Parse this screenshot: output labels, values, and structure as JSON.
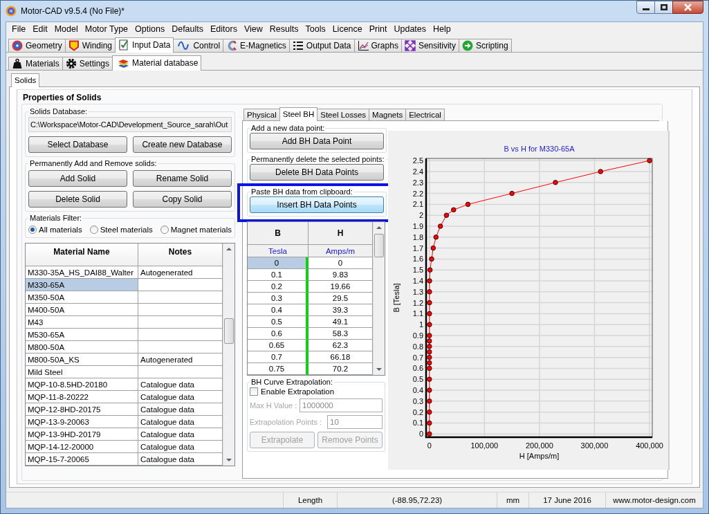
{
  "window": {
    "title": "Motor-CAD v9.5.4 (No File)*"
  },
  "menu": [
    "File",
    "Edit",
    "Model",
    "Motor Type",
    "Options",
    "Defaults",
    "Editors",
    "View",
    "Results",
    "Tools",
    "Licence",
    "Print",
    "Updates",
    "Help"
  ],
  "main_tabs": [
    {
      "label": "Geometry",
      "selected": false
    },
    {
      "label": "Winding",
      "selected": false
    },
    {
      "label": "Input Data",
      "selected": true
    },
    {
      "label": "Control",
      "selected": false
    },
    {
      "label": "E-Magnetics",
      "selected": false
    },
    {
      "label": "Output Data",
      "selected": false
    },
    {
      "label": "Graphs",
      "selected": false
    },
    {
      "label": "Sensitivity",
      "selected": false
    },
    {
      "label": "Scripting",
      "selected": false
    }
  ],
  "sub_tabs": [
    {
      "label": "Materials",
      "selected": false
    },
    {
      "label": "Settings",
      "selected": false
    },
    {
      "label": "Material database",
      "selected": true
    }
  ],
  "page_tabs": [
    {
      "label": "Solids",
      "selected": true
    }
  ],
  "properties": {
    "title": "Properties of Solids",
    "database": {
      "label": "Solids Database:",
      "path": "C:\\Workspace\\Motor-CAD\\Development_Source_sarah\\Out",
      "buttons": [
        "Select Database",
        "Create new Database"
      ]
    },
    "solids": {
      "label": "Permanently Add and Remove solids:",
      "buttons": [
        "Add Solid",
        "Rename Solid",
        "Delete Solid",
        "Copy Solid"
      ]
    },
    "filter": {
      "label": "Materials Filter:",
      "options": [
        {
          "label": "All materials",
          "selected": true
        },
        {
          "label": "Steel materials",
          "selected": false
        },
        {
          "label": "Magnet materials",
          "selected": false
        }
      ]
    },
    "materials_table": {
      "columns": [
        "Material Name",
        "Notes"
      ],
      "rows": [
        {
          "name": "M330-35A_HS_DAI88_Walter",
          "notes": "Autogenerated",
          "selected": false
        },
        {
          "name": "M330-65A",
          "selected": true
        },
        {
          "name": "M350-50A",
          "selected": false
        },
        {
          "name": "M400-50A",
          "selected": false
        },
        {
          "name": "M43",
          "selected": false
        },
        {
          "name": "M530-65A",
          "selected": false
        },
        {
          "name": "M800-50A",
          "selected": false
        },
        {
          "name": "M800-50A_KS",
          "notes": "Autogenerated",
          "selected": false
        },
        {
          "name": "Mild Steel",
          "selected": false
        },
        {
          "name": "MQP-10-8.5HD-20180",
          "notes": "Catalogue data",
          "selected": false
        },
        {
          "name": "MQP-11-8-20222",
          "notes": "Catalogue data",
          "selected": false
        },
        {
          "name": "MQP-12-8HD-20175",
          "notes": "Catalogue data",
          "selected": false
        },
        {
          "name": "MQP-13-9-20063",
          "notes": "Catalogue data",
          "selected": false
        },
        {
          "name": "MQP-13-9HD-20179",
          "notes": "Catalogue data",
          "selected": false
        },
        {
          "name": "MQP-14-12-20000",
          "notes": "Catalogue data",
          "selected": false
        },
        {
          "name": "MQP-15-7-20065",
          "notes": "Catalogue data",
          "selected": false
        }
      ]
    }
  },
  "material_tabs": [
    {
      "label": "Physical",
      "selected": false
    },
    {
      "label": "Steel BH",
      "selected": true
    },
    {
      "label": "Steel Losses",
      "selected": false
    },
    {
      "label": "Magnets",
      "selected": false
    },
    {
      "label": "Electrical",
      "selected": false
    }
  ],
  "steel_bh": {
    "add": {
      "label": "Add a new data point:",
      "button": "Add BH Data Point"
    },
    "delete": {
      "label": "Permanently delete the selected points:",
      "button": "Delete BH Data Points"
    },
    "paste": {
      "label": "Paste BH data from clipboard:",
      "button": "Insert BH Data Points",
      "highlighted": true,
      "focused": true
    },
    "bh_table": {
      "columns": [
        {
          "name": "B",
          "unit": "Tesla"
        },
        {
          "name": "H",
          "unit": "Amps/m"
        }
      ],
      "rows": [
        {
          "b": "0",
          "h": "0",
          "selected": true
        },
        {
          "b": "0.1",
          "h": "9.83",
          "selected": false
        },
        {
          "b": "0.2",
          "h": "19.66",
          "selected": false
        },
        {
          "b": "0.3",
          "h": "29.5",
          "selected": false
        },
        {
          "b": "0.4",
          "h": "39.3",
          "selected": false
        },
        {
          "b": "0.5",
          "h": "49.1",
          "selected": false
        },
        {
          "b": "0.6",
          "h": "58.3",
          "selected": false
        },
        {
          "b": "0.65",
          "h": "62.3",
          "selected": false
        },
        {
          "b": "0.7",
          "h": "66.18",
          "selected": false
        },
        {
          "b": "0.75",
          "h": "70.2",
          "selected": false
        }
      ]
    },
    "extrapolation": {
      "label": "BH Curve Extrapolation:",
      "enable": {
        "label": "Enable Extrapolation",
        "checked": false
      },
      "fields": [
        {
          "label": "Max H Value :",
          "value": "1000000",
          "disabled": true
        },
        {
          "label": "Extrapolation Points :",
          "value": "10",
          "disabled": true
        }
      ],
      "buttons": [
        {
          "label": "Extrapolate",
          "disabled": true
        },
        {
          "label": "Remove Points",
          "disabled": true
        }
      ]
    },
    "chart": {
      "chart_data": {
        "type": "line",
        "title": "B vs H for M330-65A",
        "xlabel": "H [Amps/m]",
        "ylabel": "B [Tesla]",
        "x": [
          0,
          9.83,
          19.66,
          29.5,
          39.3,
          49.1,
          58.3,
          62.3,
          66.18,
          70.2,
          75,
          80,
          90,
          110,
          130,
          160,
          200,
          280,
          1200,
          4000,
          7000,
          12000,
          20000,
          31000,
          44000,
          70000,
          150000,
          229000,
          311000,
          400000
        ],
        "grid": true,
        "series": [
          {
            "color": "#ff0000",
            "marker": "circle",
            "values": [
              0,
              0.1,
              0.2,
              0.3,
              0.4,
              0.5,
              0.6,
              0.65,
              0.7,
              0.75,
              0.8,
              0.85,
              0.9,
              1,
              1.1,
              1.2,
              1.3,
              1.4,
              1.5,
              1.6,
              1.7,
              1.8,
              1.9,
              2,
              2.05,
              2.1,
              2.2,
              2.3,
              2.4,
              2.5
            ]
          }
        ],
        "xlim": [
          -6000,
          405000
        ],
        "ylim": [
          -0.03,
          2.52
        ],
        "xticks": [
          {
            "value": 0,
            "label": "0"
          },
          {
            "value": 100000,
            "label": "100,000"
          },
          {
            "value": 200000,
            "label": "200,000"
          },
          {
            "value": 300000,
            "label": "300,000"
          },
          {
            "value": 400000,
            "label": "400,000"
          }
        ],
        "yticks": [
          0,
          0.1,
          0.2,
          0.3,
          0.4,
          0.5,
          0.6,
          0.7,
          0.8,
          0.9,
          1,
          1.1,
          1.2,
          1.3,
          1.4,
          1.5,
          1.6,
          1.7,
          1.8,
          1.9,
          2,
          2.1,
          2.2,
          2.3,
          2.4,
          2.5
        ]
      }
    }
  },
  "status_bar": [
    "Length",
    "(-88.95,72.23)",
    "mm",
    "17 June 2016",
    "www.motor-design.com"
  ]
}
